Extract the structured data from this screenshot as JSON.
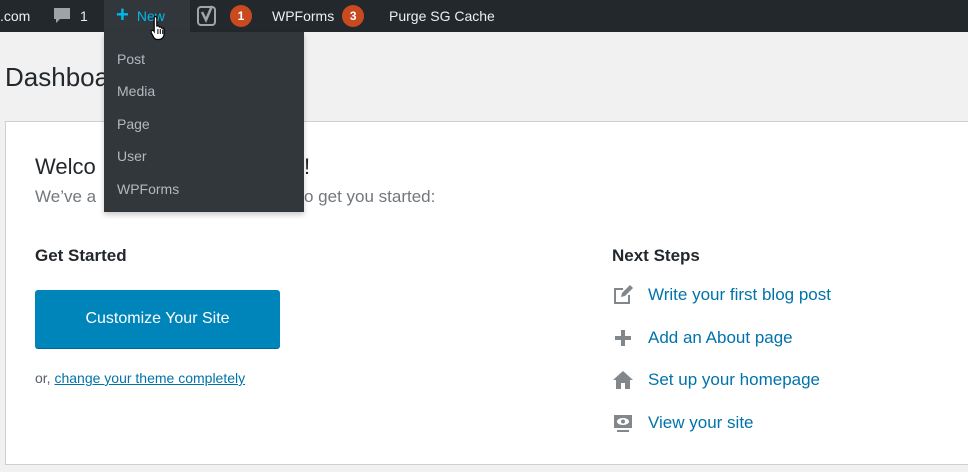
{
  "adminbar": {
    "site_label": ".com",
    "comments_count": "1",
    "new_label": "New",
    "yoast_count": "1",
    "wpforms_label": "WPForms",
    "wpforms_count": "3",
    "purge_label": "Purge SG Cache"
  },
  "new_menu": {
    "items": [
      "Post",
      "Media",
      "Page",
      "User",
      "WPForms"
    ]
  },
  "page": {
    "title": "Dashboa"
  },
  "welcome": {
    "title_start": "Welco",
    "title_end": "!",
    "subtitle_start": "We’ve a",
    "subtitle_end": "o get you started:",
    "get_started": {
      "heading": "Get Started",
      "button_label": "Customize Your Site",
      "or_text": "or, ",
      "theme_link": "change your theme completely"
    },
    "next_steps": {
      "heading": "Next Steps",
      "items": [
        {
          "label": "Write your first blog post",
          "icon": "edit-icon"
        },
        {
          "label": "Add an About page",
          "icon": "plus-icon"
        },
        {
          "label": "Set up your homepage",
          "icon": "home-icon"
        },
        {
          "label": "View your site",
          "icon": "view-icon"
        }
      ]
    }
  },
  "colors": {
    "adminbar_bg": "#23282d",
    "menu_bg": "#32373c",
    "accent": "#00b9eb",
    "badge": "#ca4a1f",
    "button": "#0085ba",
    "link": "#0073aa"
  }
}
